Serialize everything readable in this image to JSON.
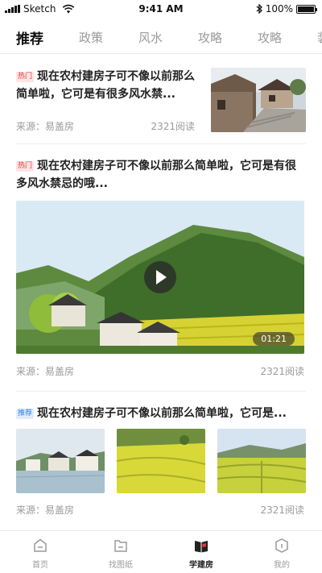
{
  "status_bar": {
    "carrier": "Sketch",
    "time": "9:41 AM",
    "battery": "100%"
  },
  "tabs": [
    {
      "label": "推荐",
      "active": true
    },
    {
      "label": "政策",
      "active": false
    },
    {
      "label": "风水",
      "active": false
    },
    {
      "label": "攻略",
      "active": false
    },
    {
      "label": "攻略",
      "active": false
    },
    {
      "label": "装",
      "active": false
    }
  ],
  "articles": [
    {
      "badge": "热门",
      "title": "现在农村建房子可不像以前那么简单啦，它可是有很多风水禁...",
      "source": "来源：易盖房",
      "reads": "2321阅读"
    },
    {
      "badge": "热门",
      "title": "现在农村建房子可不像以前那么简单啦，它可是有很多风水禁忌的哦...",
      "source": "来源：易盖房",
      "reads": "2321阅读",
      "duration": "01:21"
    },
    {
      "badge": "推荐",
      "title": "现在农村建房子可不像以前那么简单啦，它可是...",
      "source": "来源：易盖房",
      "reads": "2321阅读"
    }
  ],
  "bottom_nav": [
    {
      "label": "首页",
      "icon": "home-icon",
      "active": false
    },
    {
      "label": "找图纸",
      "icon": "blueprint-icon",
      "active": false
    },
    {
      "label": "学建房",
      "icon": "book-icon",
      "active": true
    },
    {
      "label": "我的",
      "icon": "profile-icon",
      "active": false
    }
  ],
  "colors": {
    "hot_badge": "#e4393c",
    "recommend_badge": "#2f7fe8",
    "muted_text": "#9a9a9a"
  }
}
